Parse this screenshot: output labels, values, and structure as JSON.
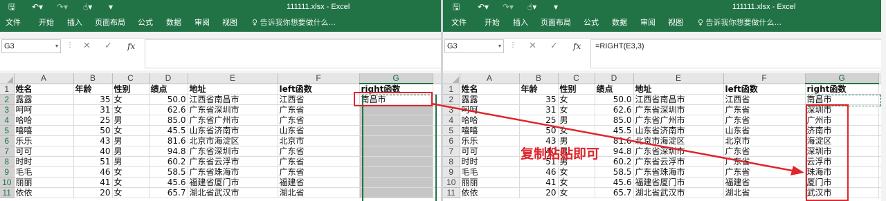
{
  "left_window": {
    "title": "111111.xlsx - Excel",
    "tabs": [
      "文件",
      "开始",
      "插入",
      "页面布局",
      "公式",
      "数据",
      "审阅",
      "视图"
    ],
    "tell_me": "告诉我你想要做什么...",
    "name_box": "G3",
    "formula": "",
    "columns": [
      "A",
      "B",
      "C",
      "D",
      "E",
      "F",
      "G"
    ]
  },
  "right_window": {
    "title": "111111.xlsx - Excel",
    "tabs": [
      "文件",
      "开始",
      "插入",
      "页面布局",
      "公式",
      "数据",
      "审阅",
      "视图"
    ],
    "tell_me": "告诉我你想要做什么...",
    "name_box": "G3",
    "formula": "=RIGHT(E3,3)",
    "columns": [
      "A",
      "B",
      "C",
      "D",
      "E",
      "F",
      "G"
    ]
  },
  "table": {
    "header": [
      "姓名",
      "年龄",
      "性别",
      "绩点",
      "地址",
      "left函数",
      "right函数"
    ],
    "rows": [
      [
        "露露",
        "35",
        "女",
        "50.0",
        "江西省南昌市",
        "江西省",
        "南昌市"
      ],
      [
        "呵呵",
        "31",
        "女",
        "62.6",
        "广东省深圳市",
        "广东省",
        "深圳市"
      ],
      [
        "哈哈",
        "25",
        "男",
        "85.0",
        "广东省广州市",
        "广东省",
        "广州市"
      ],
      [
        "嘻嘻",
        "50",
        "女",
        "45.5",
        "山东省济南市",
        "山东省",
        "济南市"
      ],
      [
        "乐乐",
        "43",
        "男",
        "81.6",
        "北京市海淀区",
        "北京市",
        "海淀区"
      ],
      [
        "可可",
        "40",
        "男",
        "94.8",
        "广东省深圳市",
        "广东省",
        "深圳市"
      ],
      [
        "时时",
        "51",
        "男",
        "60.2",
        "广东省云浮市",
        "广东省",
        "云浮市"
      ],
      [
        "毛毛",
        "46",
        "女",
        "58.5",
        "广东省珠海市",
        "广东省",
        "珠海市"
      ],
      [
        "丽丽",
        "41",
        "女",
        "45.6",
        "福建省厦门市",
        "福建省",
        "厦门市"
      ],
      [
        "依依",
        "20",
        "女",
        "65.7",
        "湖北省武汉市",
        "湖北省",
        "武汉市"
      ]
    ]
  },
  "annotation": "复制粘贴即可",
  "colors": {
    "excel_green": "#217346",
    "annotation_red": "#e0242a"
  },
  "icons": [
    "save-icon",
    "undo-icon",
    "redo-icon",
    "touch-mode-icon",
    "customize-qat-icon",
    "lightbulb-icon",
    "cancel-icon",
    "enter-icon",
    "function-icon"
  ]
}
